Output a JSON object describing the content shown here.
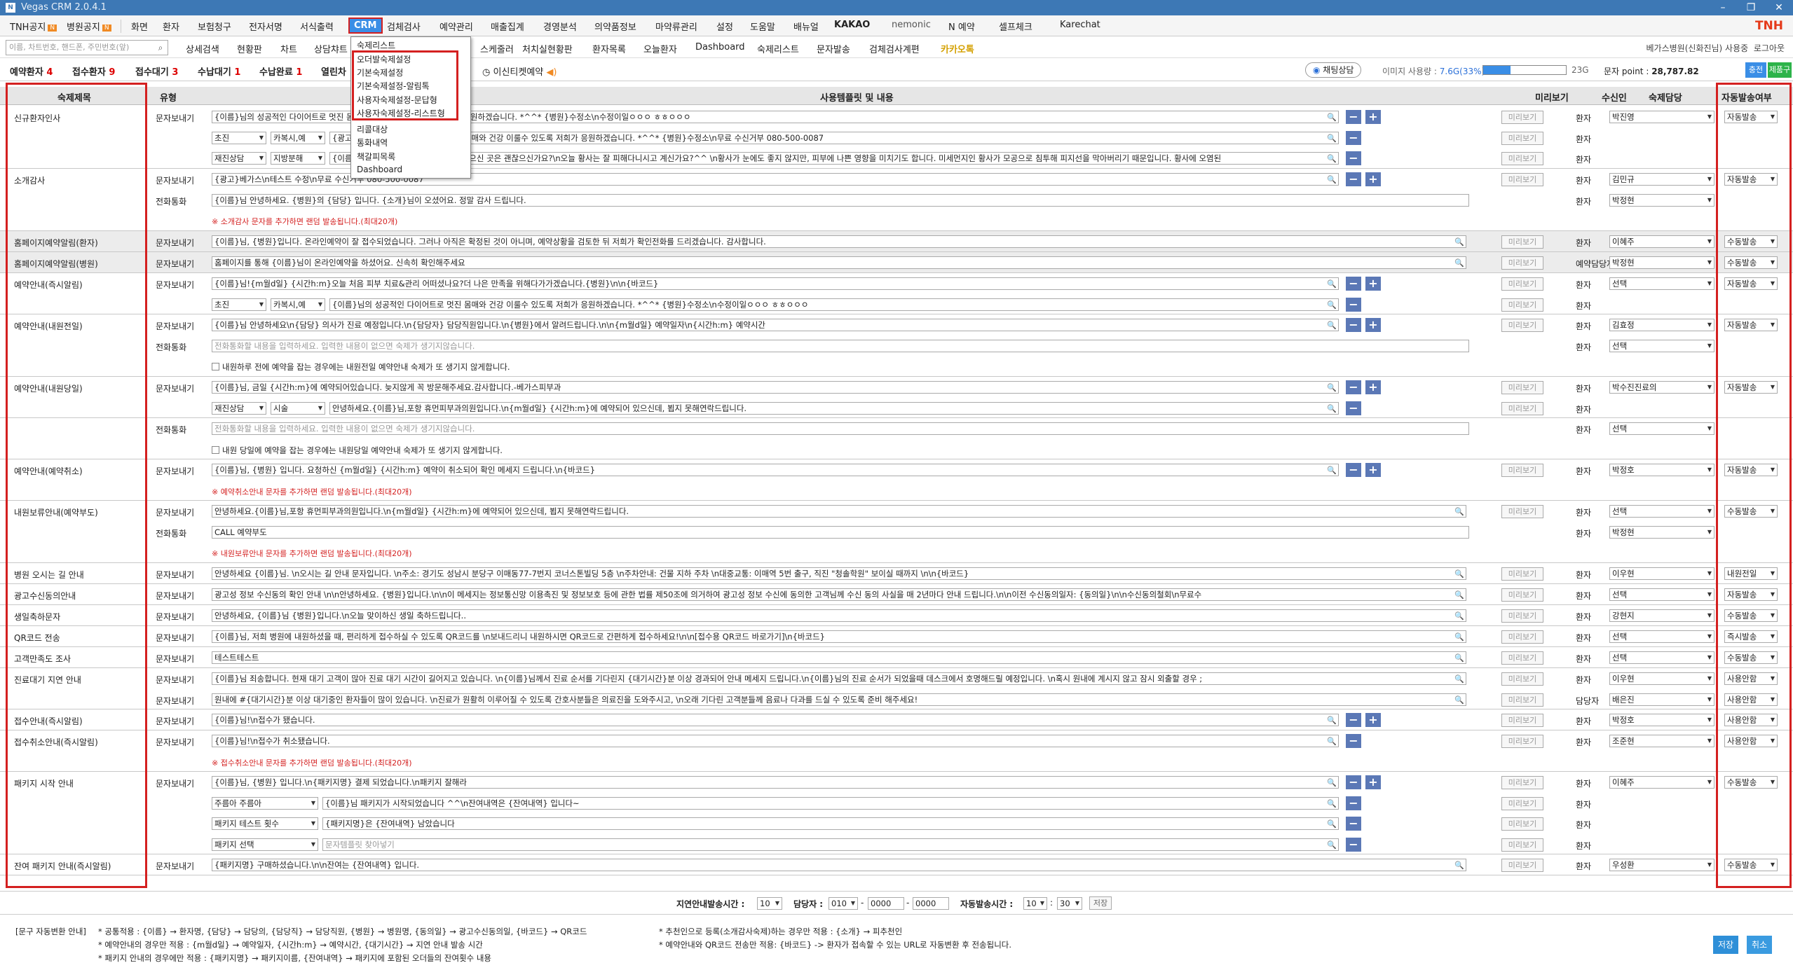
{
  "window": {
    "title": "Vegas CRM 2.0.4.1",
    "min": "–",
    "max": "❐",
    "close": "✕"
  },
  "menu": [
    {
      "label": "TNH공지",
      "badge": "N"
    },
    {
      "label": "병원공지",
      "badge": "N"
    },
    {
      "label": "화면"
    },
    {
      "label": "환자"
    },
    {
      "label": "보험청구"
    },
    {
      "label": "전자서명"
    },
    {
      "label": "서식출력"
    },
    {
      "label": "CRM"
    },
    {
      "label": "검체검사"
    },
    {
      "label": "예약관리"
    },
    {
      "label": "매출집계"
    },
    {
      "label": "경영분석"
    },
    {
      "label": "의약품정보"
    },
    {
      "label": "마약류관리"
    },
    {
      "label": "설정"
    },
    {
      "label": "도움말"
    },
    {
      "label": "배뉴얼"
    },
    {
      "label": "KAKAO"
    },
    {
      "label": "nemonic"
    },
    {
      "label": "N 예약"
    },
    {
      "label": "셀프체크"
    },
    {
      "label": "Karechat"
    }
  ],
  "brand": "TNH",
  "search": {
    "placeholder": "이름, 차트번호, 핸드폰, 주민번호(앞)"
  },
  "subnav": [
    "상세검색",
    "현황판",
    "차트",
    "상담챠트",
    "",
    "",
    "스케줄러",
    "처치실현황판",
    "환자목록",
    "오늘환자",
    "Dashboard",
    "숙제리스트",
    "문자발송",
    "검체검사계편",
    "카카오톡"
  ],
  "sub_right": {
    "user": "베가스병원(신화진님) 사용중",
    "logout": "로그아웃"
  },
  "status": [
    {
      "label": "예약환자",
      "n": "4"
    },
    {
      "label": "접수환자",
      "n": "9"
    },
    {
      "label": "접수대기",
      "n": "3"
    },
    {
      "label": "수납대기",
      "n": "1"
    },
    {
      "label": "수납완료",
      "n": "1"
    },
    {
      "label": "열린차",
      "n": ""
    }
  ],
  "status_extra": {
    "ticket": "이신티켓예약",
    "chat": "채팅상담",
    "usage_label": "이미지 사용량 :",
    "usage_val": "7.6G(33%)",
    "usage_total": "23G",
    "pts_label": "문자 point :",
    "pts": "28,787.82",
    "btn1": "충전",
    "btn2": "제품구매"
  },
  "crm_menu": [
    "숙제리스트",
    "오더발숙제설정",
    "기본숙제설정",
    "기본숙제설정-알림톡",
    "사용자숙제설정-문답형",
    "사용자숙제설정-리스트형",
    "리콜대상",
    "통화내역",
    "책갈피목록",
    "Dashboard"
  ],
  "headers": {
    "title": "숙제제목",
    "type": "유형",
    "template": "사용템플릿 및 내용",
    "preview": "미리보기",
    "recipient": "수신인",
    "owner": "숙제담당",
    "auto": "자동발송여부"
  },
  "labels": {
    "text": "문자보내기",
    "call": "전화통화",
    "preview": "미리보기",
    "patient": "환자",
    "mg": "🔍",
    "plus": "+",
    "minus": "−"
  },
  "sections": [
    {
      "title": "신규환자인사",
      "rows": [
        {
          "type": "문자보내기",
          "content": "{이름}님의 성공적인 다이어트로 멋진 몸매와 건강 이룰수 있도록 저희가 응원하겠습니다. *^^* {병원}수정소\\n수정이일ㅇㅇㅇ ㅎㅎㅇㅇㅇ",
          "recipient": "환자",
          "owner": "박진영",
          "auto": "자동발송",
          "buttons": "both",
          "selects": []
        },
        {
          "type": "",
          "content": "{광고}님의 성공적인 다이어트로 멋진 몸매와 건강 이룰수 있도록 저희가 응원하겠습니다. *^^* {병원}수정소\\n무료 수신거부 080-500-0087",
          "recipient": "환자",
          "buttons": "minus",
          "selects": [
            "초진",
            "카복시,예"
          ]
        },
        {
          "type": "",
          "content": "{이름}님 안녕하세요. 오늘 피부 시술 받으신 곳은 괜찮으신가요?\\n오늘 황사는 잘 피해다니시고 계신가요?^^ \\n황사가 눈에도 좋지 않지만, 피부에 나쁜 영향을 미치기도 합니다. 미세먼지인 황사가 모공으로 침투해 피지선을 막아버리기 때문입니다. 황사에 오염된",
          "recipient": "환자",
          "buttons": "minus",
          "selects": [
            "재진상담",
            "지방분해"
          ]
        }
      ]
    },
    {
      "title": "소개감사",
      "rows": [
        {
          "type": "문자보내기",
          "content": "{광고}베가스\\n테스트 수정\\n무료 수신거부 080-500-0087",
          "recipient": "환자",
          "owner": "김민규",
          "auto": "자동발송",
          "buttons": "both",
          "selects": []
        },
        {
          "type": "전화통화",
          "content": "{이름}님 안녕하세요. {병원}의 {담당} 입니다. {소개}님이 오셨어요. 정말 감사 드립니다.",
          "recipient": "환자",
          "owner": "박정현",
          "wide": true
        }
      ],
      "note": "※ 소개감사 문자를 추가하면 랜덤 발송됩니다.(최대20개)"
    },
    {
      "title": "홈페이지예약알림(환자)",
      "gray": true,
      "rows": [
        {
          "type": "문자보내기",
          "content": "{이름}님, {병원}입니다. 온라인예약이 잘 접수되었습니다. 그러나 아직은 확정된 것이 아니며, 예약상황을 검토한 뒤 저희가 확인전화를 드리겠습니다. 감사합니다.",
          "recipient": "환자",
          "owner": "이혜주",
          "auto": "수동발송",
          "long": true
        }
      ]
    },
    {
      "title": "홈페이지예약알림(병원)",
      "gray": true,
      "rows": [
        {
          "type": "문자보내기",
          "content": "홈페이지를 통해 {이름}님이 온라인예약을 하셨어요. 신속히 확인해주세요",
          "recipient": "예약담당자",
          "owner": "박정현",
          "auto": "수동발송",
          "long": true
        }
      ]
    },
    {
      "title": "예약안내(즉시알림)",
      "rows": [
        {
          "type": "문자보내기",
          "content": "{이름}님!{m월d일} {시간h:m}오늘 처음 피부 치료&관리 어떠셨나요?더 나은 만족을 위해다가가겠습니다.{병원}\\n\\n{바코드}",
          "recipient": "환자",
          "owner": "선택",
          "auto": "자동발송",
          "buttons": "both",
          "selects": []
        },
        {
          "type": "",
          "content": "{이름}님의 성공적인 다이어트로 멋진 몸매와 건강 이룰수 있도록 저희가 응원하겠습니다. *^^* {병원}수정소\\n수정이일ㅇㅇㅇ ㅎㅎㅇㅇㅇ",
          "recipient": "환자",
          "buttons": "minus",
          "selects": [
            "초진",
            "카복시,예"
          ]
        }
      ]
    },
    {
      "title": "예약안내(내원전일)",
      "rows": [
        {
          "type": "문자보내기",
          "content": "{이름}님 안녕하세요\\n{담당} 의사가 진료 예정입니다.\\n{담당자} 담당직원입니다.\\n{병원}에서 알려드립니다.\\n\\n{m월d일} 예약일자\\n{시간h:m} 예약시간",
          "recipient": "환자",
          "owner": "김효정",
          "auto": "자동발송",
          "buttons": "both",
          "selects": []
        },
        {
          "type": "전화통화",
          "content": "전화통화할 내용을 입력하세요. 입력한 내용이 없으면 숙제가 생기지않습니다.",
          "recipient": "환자",
          "owner": "선택",
          "wide": true,
          "ph": true
        }
      ],
      "check": "내원하루 전에 예약을 잡는 경우에는 내원전일 예약안내 숙제가 또 생기지 않게합니다."
    },
    {
      "title": "예약안내(내원당일)",
      "rows": [
        {
          "type": "문자보내기",
          "content": "{이름}님, 금일 {시간h:m}에 예약되어있습니다. 늦지않게 꼭 방문해주세요.감사합니다.-베가스피부과",
          "recipient": "환자",
          "owner": "박수진진료의",
          "auto": "자동발송",
          "buttons": "both",
          "selects": []
        },
        {
          "type": "",
          "content": "안녕하세요.{이름}님,포항 휴먼피부과의원입니다.\\n{m월d일} {시간h:m}에 예약되어 있으신데, 뵙지 못해연락드립니다.",
          "recipient": "환자",
          "buttons": "minus",
          "selects": [
            "재진상담",
            "시술"
          ]
        }
      ]
    },
    {
      "title": "",
      "rows": [
        {
          "type": "전화통화",
          "content": "전화통화할 내용을 입력하세요. 입력한 내용이 없으면 숙제가 생기지않습니다.",
          "recipient": "환자",
          "owner": "선택",
          "wide": true,
          "ph": true
        }
      ],
      "check": "내원 당일에 예약을 잡는 경우에는 내원당일 예약안내 숙제가 또 생기지 않게합니다."
    },
    {
      "title": "예약안내(예약취소)",
      "rows": [
        {
          "type": "문자보내기",
          "content": "{이름}님, {병원} 입니다. 요청하신 {m월d일} {시간h:m} 예약이 취소되어 확인 메세지 드립니다.\\n{바코드}",
          "recipient": "환자",
          "owner": "박정호",
          "auto": "자동발송",
          "buttons": "both",
          "selects": []
        }
      ],
      "note": "※ 예약취소안내 문자를 추가하면 랜덤 발송됩니다.(최대20개)"
    },
    {
      "title": "내원보류안내(예약부도)",
      "rows": [
        {
          "type": "문자보내기",
          "content": "안녕하세요.{이름}님,포항 휴먼피부과의원입니다.\\n{m월d일} {시간h:m}에 예약되어 있으신데, 뵙지 못해연락드립니다.",
          "recipient": "환자",
          "owner": "선택",
          "auto": "수동발송",
          "long": true
        },
        {
          "type": "전화통화",
          "content": "CALL 예약부도",
          "recipient": "환자",
          "owner": "박정현",
          "wide": true
        }
      ],
      "note": "※ 내원보류안내 문자를 추가하면 랜덤 발송됩니다.(최대20개)"
    },
    {
      "title": "병원 오시는 길 안내",
      "rows": [
        {
          "type": "문자보내기",
          "content": "안녕하세요 {이름}님. \\n오시는 길 안내 문자입니다. \\n주소: 경기도 성남시 분당구 이매동77-7번지 코너스톤빌딩 5층 \\n주차안내: 건물 지하 주차 \\n대중교통: 이매역 5번 출구, 직진 \"청솔학원\" 보이실 때까지 \\n\\n{바코드}",
          "recipient": "환자",
          "owner": "이우현",
          "auto": "내원전일",
          "long": true
        }
      ]
    },
    {
      "title": "광고수신동의안내",
      "rows": [
        {
          "type": "문자보내기",
          "content": "광고성 정보 수신동의 확인 안내 \\n\\n안녕하세요. {병원}입니다.\\n\\n이 메세지는 정보통신망 이용촉진 및 정보보호 등에 관한 법률 제50조에 의거하여 광고성 정보 수신에 동의한 고객님께 수신 동의 사실을 매 2년마다 안내 드립니다.\\n\\n이전 수신동의일자: {동의일}\\n\\n수신동의철회\\n무료수",
          "recipient": "환자",
          "owner": "선택",
          "auto": "자동발송",
          "long": true
        }
      ]
    },
    {
      "title": "생일축하문자",
      "rows": [
        {
          "type": "문자보내기",
          "content": "안녕하세요, {이름}님 {병원}입니다.\\n오늘 맞이하신 생일 축하드립니다..",
          "recipient": "환자",
          "owner": "강현지",
          "auto": "수동발송",
          "long": true
        }
      ]
    },
    {
      "title": "QR코드 전송",
      "rows": [
        {
          "type": "문자보내기",
          "content": "{이름}님, 저희 병원에 내원하셨을 때, 편리하게 접수하실 수 있도록 QR코드를 \\n보내드리니 내원하시면 QR코드로 간편하게 접수하세요!\\n\\n[접수용 QR코드 바로가기]\\n{바코드}",
          "recipient": "환자",
          "owner": "선택",
          "auto": "즉시발송",
          "long": true
        }
      ]
    },
    {
      "title": "고객만족도 조사",
      "rows": [
        {
          "type": "문자보내기",
          "content": "테스트테스트",
          "recipient": "환자",
          "owner": "선택",
          "auto": "수동발송",
          "long": true
        }
      ]
    },
    {
      "title": "진료대기 지연 안내",
      "rows": [
        {
          "type": "문자보내기",
          "content": "{이름}님 죄송합니다. 현재 대기 고객이 많아 진료 대기 시간이 길어지고 있습니다. \\n{이름}님께서 진료 순서를 기다린지 {대기시간}분 이상 경과되어 안내 메세지 드립니다.\\n{이름}님의 진료 순서가 되었을때 데스크에서 호명해드릴 예정입니다. \\n혹시 원내에 계시지 않고 잠시 외출할 경우 ;",
          "recipient": "환자",
          "owner": "이우현",
          "auto": "사용안함",
          "long": true
        },
        {
          "type": "문자보내기",
          "content": "원내에 #{대기시간}분 이상 대기중인 환자들이 많이 있습니다. \\n진료가 원활히 이루어질 수 있도록 간호사분들은 의료진을 도와주시고, \\n오래 기다린 고객분들께 음료나 다과를 드실 수 있도록 준비 해주세요!",
          "recipient": "담당자",
          "owner": "배은진",
          "auto": "사용안함",
          "long": true
        }
      ]
    },
    {
      "title": "접수안내(즉시알림)",
      "rows": [
        {
          "type": "문자보내기",
          "content": "{이름}님!\\n접수가 됐습니다.",
          "recipient": "환자",
          "owner": "박정호",
          "auto": "사용안함",
          "buttons": "both",
          "selects": []
        }
      ]
    },
    {
      "title": "접수취소안내(즉시알림)",
      "rows": [
        {
          "type": "문자보내기",
          "content": "{이름}님!\\n접수가 취소됐습니다.",
          "recipient": "환자",
          "owner": "조준현",
          "auto": "사용안함",
          "buttons": "minus",
          "selects": []
        }
      ],
      "note": "※ 접수취소안내 문자를 추가하면 랜덤 발송됩니다.(최대20개)"
    },
    {
      "title": "패키지 시작 안내",
      "rows": [
        {
          "type": "문자보내기",
          "content": "{이름}님, {병원} 입니다.\\n{패키지명} 결제 되었습니다.\\n패키지 잘해라",
          "recipient": "환자",
          "owner": "이혜주",
          "auto": "수동발송",
          "buttons": "both",
          "selects": []
        },
        {
          "type": "",
          "content": "{이름}님 패키지가 시작되었습니다 ^^\\n잔여내역은 {잔여내역} 입니다~",
          "recipient": "환자",
          "buttons": "minus",
          "selects": [
            "주름아 주름아"
          ],
          "psel": true
        },
        {
          "type": "",
          "content": "{패키지명}은 {잔여내역} 남았습니다",
          "recipient": "환자",
          "buttons": "minus",
          "selects": [
            "패키지 테스트 횟수"
          ],
          "psel": true
        },
        {
          "type": "",
          "content": "문자템플릿 찾아넣기",
          "recipient": "환자",
          "buttons": "minus",
          "selects": [
            "패키지 선택"
          ],
          "psel": true,
          "ph": true
        }
      ]
    },
    {
      "title": "잔여 패키지 안내(즉시알림)",
      "rows": [
        {
          "type": "문자보내기",
          "content": "{패키지명} 구매하셨습니다.\\n\\n잔여는 {잔여내역} 입니다.",
          "recipient": "환자",
          "owner": "우성환",
          "auto": "수동발송",
          "long": true
        }
      ]
    }
  ],
  "bottom": {
    "delay_label": "지연안내발송시간 :",
    "delay_val": "10",
    "owner_label": "담당자 :",
    "owner_code": "010",
    "owner_mid": "0000",
    "owner_last": "0000",
    "auto_label": "자동발송시간 :",
    "auto_h": "10",
    "auto_m": "30",
    "save_small": "저장"
  },
  "guide": {
    "title": "[문구 자동변환 안내]",
    "l1": "* 공통적용 : {이름} → 환자명, {담당} → 담당의, {담당직} → 담당직원, {병원} → 병원명, {동의일} → 광고수신동의일, {바코드} → QR코드",
    "l2": "* 예약안내의 경우만 적용 : {m월d일} → 예약일자, {시간h:m} → 예약시간, {대기시간} → 지연 안내 발송 시간",
    "l3": "* 패키지 안내의 경우에만 적용 : {패키지명} → 패키지이름, {잔여내역} → 패키지에 포함된 오더들의 잔여횟수 내용",
    "r1": "* 추천인으로 등록(소개감사숙제)하는 경우만 적용 : {소개} → 피추천인",
    "r2": "* 예약안내와 QR코드 전송만 적용: {바코드} -> 환자가 접속할 수 있는 URL로 자동변환 후 전송됩니다."
  },
  "actions": {
    "save": "저장",
    "cancel": "취소"
  },
  "colors": {
    "accent": "#3a8ee6",
    "highlight": "#d42020",
    "titlebar": "#3d78b5",
    "plusminus": "#5b78b6"
  }
}
